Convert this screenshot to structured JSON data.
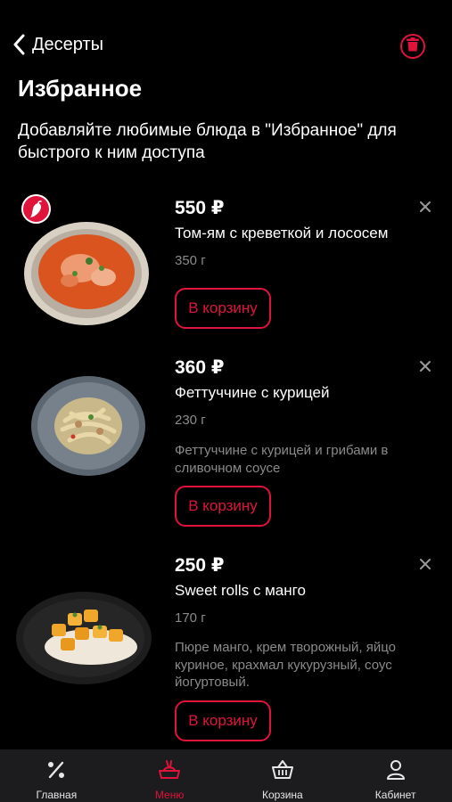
{
  "header": {
    "back_label": "Десерты",
    "title": "Избранное",
    "subtitle": "Добавляйте любимые блюда в \"Избранное\" для быстрого к ним доступа"
  },
  "items": [
    {
      "price": "550 ₽",
      "name": "Том-ям с креветкой и лососем",
      "weight": "350 г",
      "description": "",
      "button_label": "В корзину",
      "badge": "chili-pepper-icon"
    },
    {
      "price": "360 ₽",
      "name": "Феттуччине с курицей",
      "weight": "230 г",
      "description": "Феттуччине с курицей и грибами в сливочном соусе",
      "button_label": "В корзину"
    },
    {
      "price": "250 ₽",
      "name": "Sweet rolls с манго",
      "weight": "170 г",
      "description": "Пюре манго, крем творожный, яйцо куриное, крахмал кукурузный, соус йогуртовый.",
      "button_label": "В корзину"
    }
  ],
  "tabbar": {
    "tabs": [
      {
        "label": "Главная",
        "icon": "percent-icon",
        "active": false
      },
      {
        "label": "Меню",
        "icon": "menu-dish-icon",
        "active": true
      },
      {
        "label": "Корзина",
        "icon": "basket-icon",
        "active": false
      },
      {
        "label": "Кабинет",
        "icon": "user-icon",
        "active": false
      }
    ]
  },
  "colors": {
    "accent": "#e0143b",
    "background": "#000000",
    "muted_text": "#8a8a8a",
    "tabbar_bg": "#1c1c1e"
  }
}
